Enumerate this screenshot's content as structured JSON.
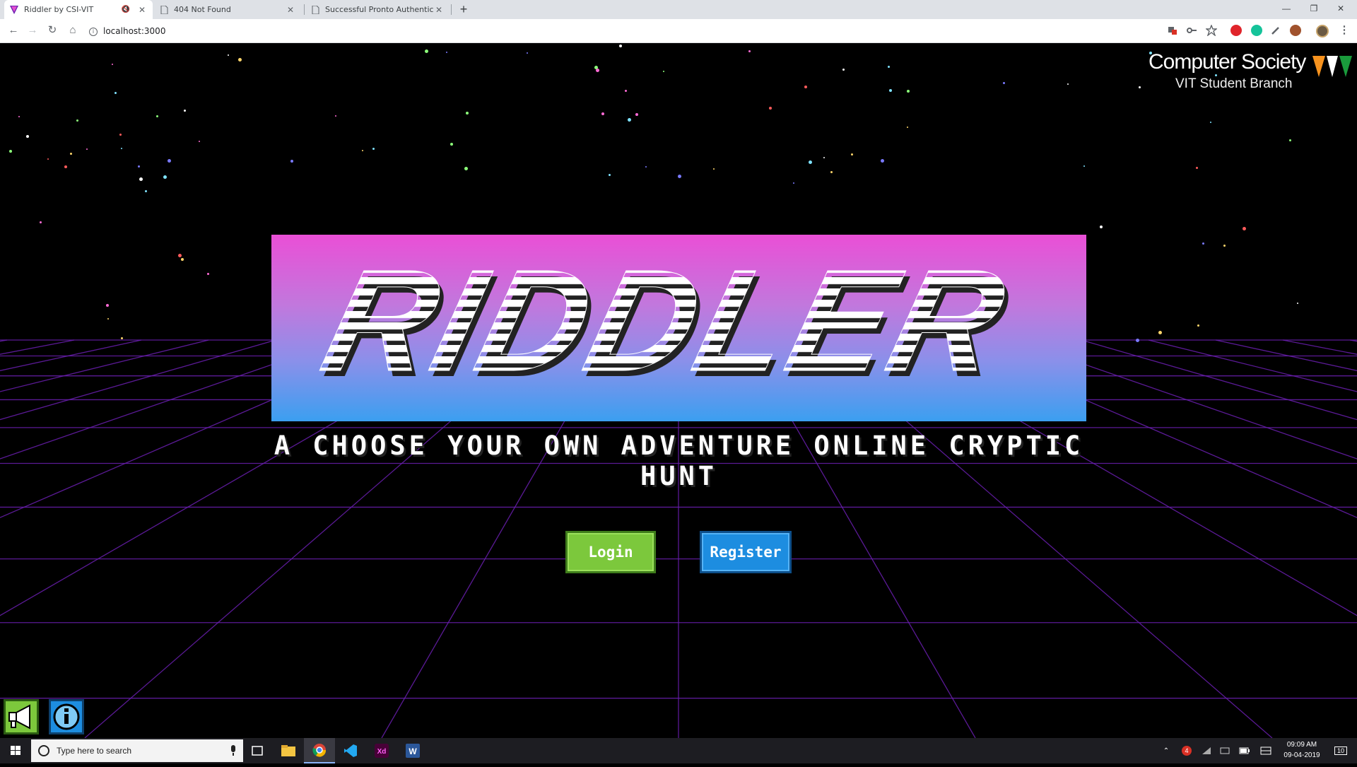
{
  "browser": {
    "tabs": [
      {
        "title": "Riddler by CSI-VIT",
        "active": true
      },
      {
        "title": "404 Not Found",
        "active": false
      },
      {
        "title": "Successful Pronto Authentication",
        "active": false
      }
    ],
    "new_tab_symbol": "+",
    "window_controls": {
      "minimize": "—",
      "restore": "❐",
      "close": "✕"
    },
    "nav": {
      "back": "←",
      "forward": "→",
      "reload": "↻",
      "home": "⌂"
    },
    "url": "localhost:3000",
    "extension_icons": [
      "translate-icon",
      "key-icon",
      "star-icon",
      "ublock-icon",
      "grammarly-icon",
      "eyedropper-icon",
      "cookie-icon",
      "profile-icon",
      "menu-icon"
    ]
  },
  "page": {
    "logo": {
      "title": "Computer Society",
      "subtitle": "VIT Student Branch"
    },
    "banner": {
      "text": "RIDDLER"
    },
    "tagline": "A CHOOSE YOUR OWN ADVENTURE ONLINE CRYPTIC HUNT",
    "buttons": {
      "login": "Login",
      "register": "Register"
    },
    "corner_buttons": [
      "megaphone-icon",
      "info-icon"
    ],
    "colors": {
      "login": "#7cc83c",
      "register": "#1d8de0",
      "grid": "#6a1fb0",
      "banner_top": "#ea4fd6",
      "banner_bottom": "#3b9ff0"
    }
  },
  "taskbar": {
    "search_placeholder": "Type here to search",
    "apps": [
      "task-view-icon",
      "file-explorer-icon",
      "chrome-icon",
      "vscode-icon",
      "adobe-xd-icon",
      "word-icon"
    ],
    "notification_badge": "4",
    "time": "09:09 AM",
    "date": "09-04-2019",
    "action_center_count": "10"
  }
}
